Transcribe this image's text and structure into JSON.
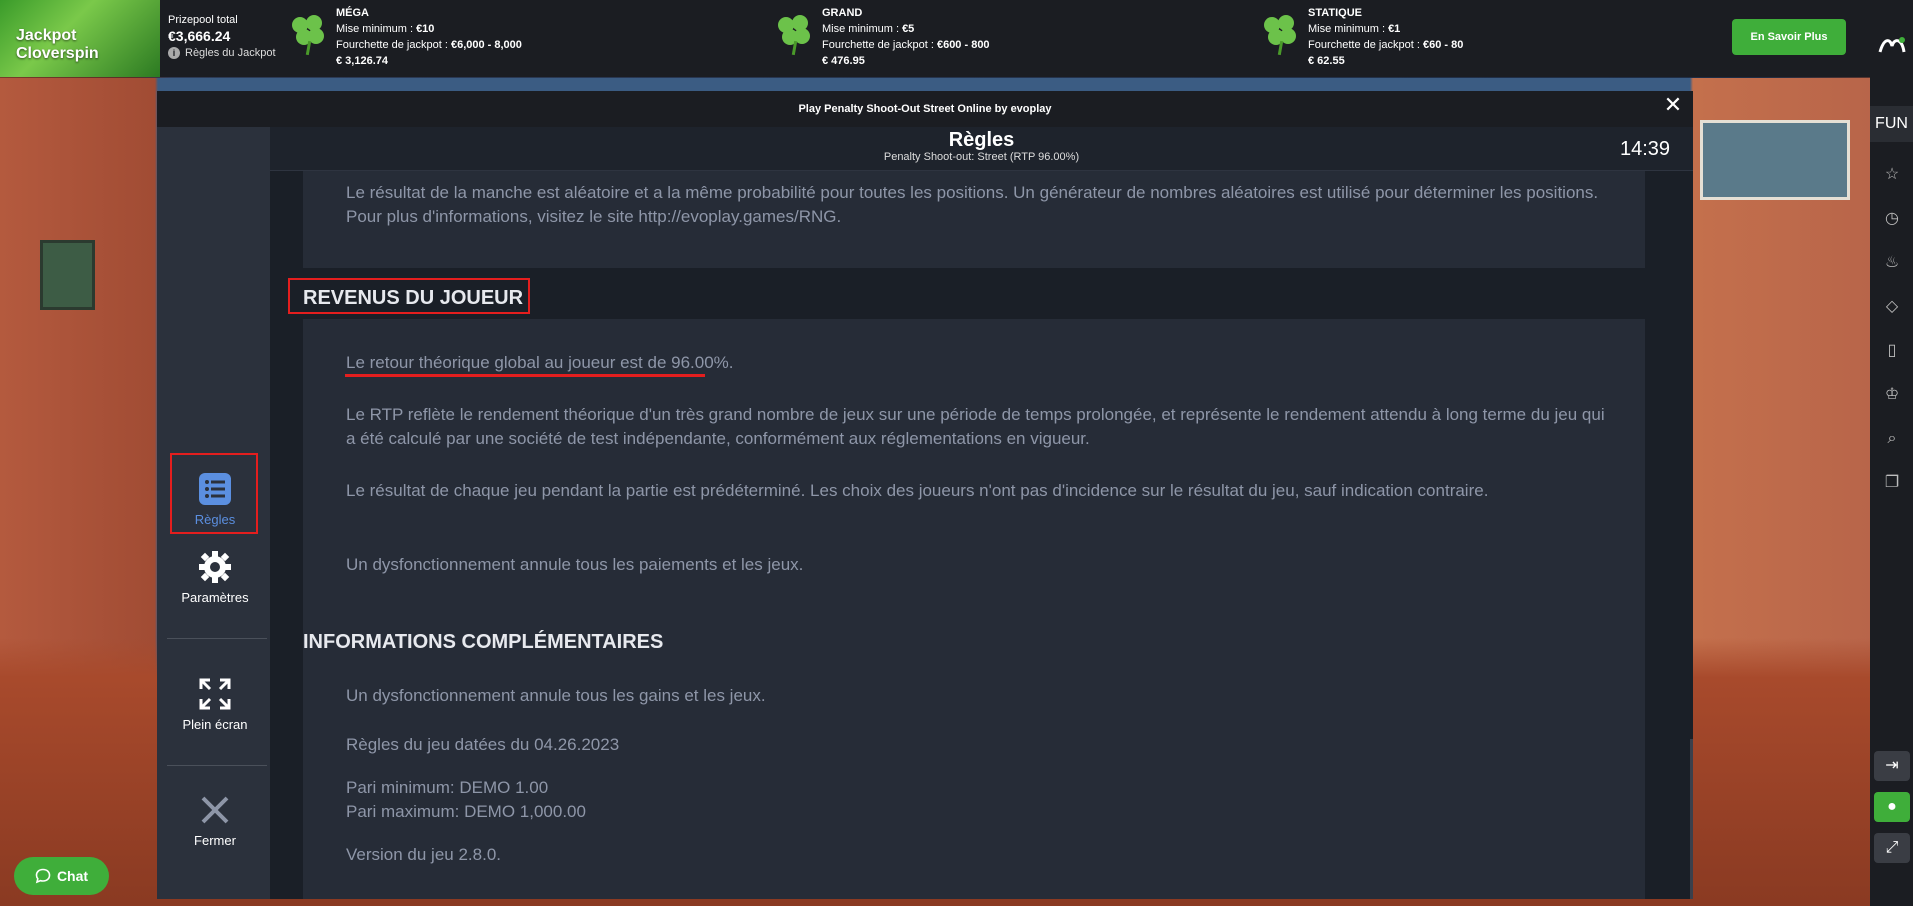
{
  "jackpot": {
    "title": "Jackpot Cloverspin",
    "prizepool_label": "Prizepool total",
    "prizepool_amount": "€3,666.24",
    "rules_link": "Règles du Jackpot",
    "tiers": [
      {
        "name": "MÉGA",
        "min_label": "Mise minimum : ",
        "min_value": "€10",
        "range_label": "Fourchette de jackpot : ",
        "range_value": "€6,000 - 8,000",
        "amount": "€ 3,126.74"
      },
      {
        "name": "GRAND",
        "min_label": "Mise minimum : ",
        "min_value": "€5",
        "range_label": "Fourchette de jackpot : ",
        "range_value": "€600 - 800",
        "amount": "€ 476.95"
      },
      {
        "name": "STATIQUE",
        "min_label": "Mise minimum : ",
        "min_value": "€1",
        "range_label": "Fourchette de jackpot : ",
        "range_value": "€60 - 80",
        "amount": "€ 62.55"
      }
    ],
    "more_button": "En Savoir Plus"
  },
  "rail": {
    "mode": "FUN",
    "icons": [
      "star-icon",
      "clock-icon",
      "fire-icon",
      "diamond-icon",
      "bookmark-icon",
      "trophy-icon",
      "search-icon",
      "copy-icon"
    ],
    "bottom_icons": [
      "login-icon",
      "user-icon",
      "fullscreen-icon"
    ]
  },
  "modal": {
    "window_title": "Play Penalty Shoot-Out Street Online by evoplay",
    "header_title": "Règles",
    "header_subtitle": "Penalty Shoot-out: Street (RTP 96.00%)",
    "clock": "14:39"
  },
  "menu": {
    "rules": "Règles",
    "settings": "Paramètres",
    "fullscreen": "Plein écran",
    "close": "Fermer"
  },
  "content": {
    "top_paragraph": "Le résultat de la manche est aléatoire et a la même probabilité pour toutes les positions. Un générateur de nombres aléatoires est utilisé pour déterminer les positions. Pour plus d'informations, visitez le site http://evoplay.games/RNG.",
    "rtp_heading": "REVENUS DU JOUEUR",
    "rtp_line": "Le retour théorique global au joueur est de 96.00%.",
    "rtp_para1": "Le RTP reflète le rendement théorique d'un très grand nombre de jeux sur une période de temps prolongée, et représente le rendement attendu à long terme du jeu qui a été calculé par une société de test indépendante, conformément aux réglementations en vigueur.",
    "rtp_para2": "Le résultat de chaque jeu pendant la partie est prédéterminé. Les choix des joueurs n'ont pas d'incidence sur le résultat du jeu, sauf indication contraire.",
    "rtp_para3": " Un dysfonctionnement annule tous les paiements et les jeux.",
    "info_heading": "INFORMATIONS COMPLÉMENTAIRES",
    "info_malfunction": "Un dysfonctionnement annule tous les gains et les jeux.",
    "info_date": "Règles du jeu datées du 04.26.2023",
    "info_min_bet": "Pari minimum: DEMO 1.00",
    "info_max_bet": "Pari maximum: DEMO 1,000.00",
    "info_version": "Version du jeu 2.8.0."
  },
  "chat": {
    "label": "Chat"
  },
  "colors": {
    "accent_green": "#3fae3a",
    "highlight_red": "#e41e1e",
    "active_blue": "#5b8fe0"
  }
}
